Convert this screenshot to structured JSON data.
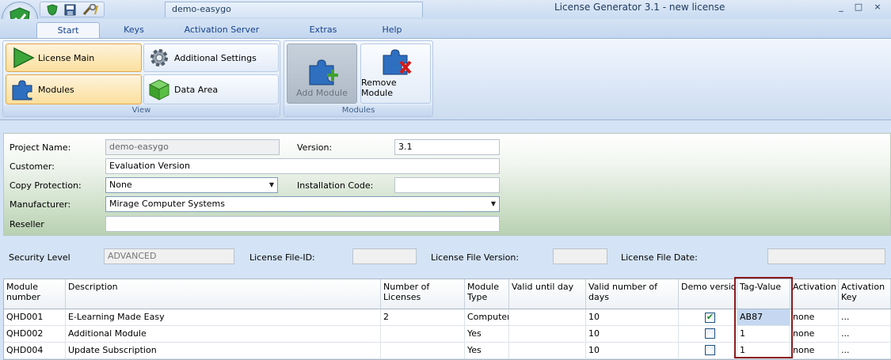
{
  "window": {
    "title": "License Generator 3.1 - new license",
    "doc_tab": "demo-easygo",
    "controls": [
      "_",
      "□",
      "×"
    ]
  },
  "ribbon_tabs": [
    "Start",
    "Keys",
    "Activation Server",
    "Extras",
    "Help"
  ],
  "ribbon": {
    "view_group": {
      "label": "View",
      "buttons": [
        "License Main",
        "Additional Settings",
        "Modules",
        "Data Area"
      ]
    },
    "modules_group": {
      "label": "Modules",
      "add_module": "Add Module",
      "remove_module": "Remove Module"
    }
  },
  "form": {
    "project_name_label": "Project Name:",
    "project_name": "demo-easygo",
    "version_label": "Version:",
    "version": "3.1",
    "customer_label": "Customer:",
    "customer": "Evaluation Version",
    "copy_protection_label": "Copy Protection:",
    "copy_protection": "None",
    "installation_code_label": "Installation Code:",
    "installation_code": "",
    "manufacturer_label": "Manufacturer:",
    "manufacturer": "Mirage Computer Systems",
    "reseller_label": "Reseller",
    "reseller": ""
  },
  "security": {
    "security_level_label": "Security Level",
    "security_level": "ADVANCED",
    "file_id_label": "License File-ID:",
    "file_id": "",
    "file_version_label": "License File Version:",
    "file_version": "",
    "file_date_label": "License File Date:",
    "file_date": ""
  },
  "table": {
    "headers": [
      "Module number",
      "Description",
      "Number of Licenses",
      "Module Type",
      "Valid until day",
      "Valid number of days",
      "Demo version",
      "Tag-Value",
      "Activation",
      "Activation Key"
    ],
    "rows": [
      {
        "module": "QHD001",
        "description": "E-Learning Made Easy",
        "licenses": "2",
        "type": "Computer",
        "valid_until": "",
        "valid_days": "10",
        "demo": true,
        "tag": "AB87",
        "activation": "none",
        "key": "..."
      },
      {
        "module": "QHD002",
        "description": "Additional Module",
        "licenses": "",
        "type": "Yes",
        "valid_until": "",
        "valid_days": "10",
        "demo": false,
        "tag": "1",
        "activation": "none",
        "key": "..."
      },
      {
        "module": "QHD004",
        "description": "Update Subscription",
        "licenses": "",
        "type": "Yes",
        "valid_until": "",
        "valid_days": "10",
        "demo": false,
        "tag": "1",
        "activation": "none",
        "key": "..."
      }
    ]
  }
}
